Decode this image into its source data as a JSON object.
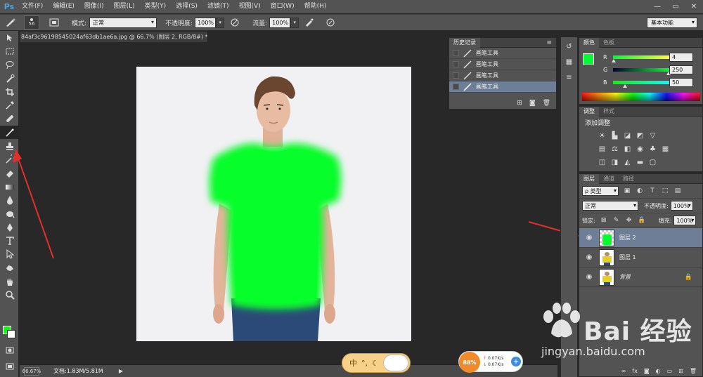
{
  "app": {
    "logo": "Ps"
  },
  "menu": [
    "文件(F)",
    "编辑(E)",
    "图像(I)",
    "图层(L)",
    "类型(Y)",
    "选择(S)",
    "滤镜(T)",
    "视图(V)",
    "窗口(W)",
    "帮助(H)"
  ],
  "window_controls": {
    "minimize": "—",
    "restore": "▭",
    "close": "✕"
  },
  "options": {
    "brush_size": "56",
    "mode_label": "模式:",
    "mode_value": "正常",
    "opacity_label": "不透明度:",
    "opacity_value": "100%",
    "flow_label": "流量:",
    "flow_value": "100%",
    "workspace": "基本功能"
  },
  "document": {
    "tab_title": "84af3c96198545024af63db1ae6a.jpg @ 66.7% (图层 2, RGB/8#) *",
    "zoom": "66.67%",
    "doc_size": "文档:1.83M/5.81M"
  },
  "history": {
    "tabs": [
      "历史记录"
    ],
    "items": [
      "画笔工具",
      "画笔工具",
      "画笔工具",
      "画笔工具"
    ],
    "selected_index": 3
  },
  "color_panel": {
    "tabs": [
      "颜色",
      "色板"
    ],
    "foreground": "#04fa32",
    "r": "4",
    "g": "250",
    "b": "50",
    "r_level": 0.016,
    "g_level": 0.98,
    "b_level": 0.196
  },
  "adjustments": {
    "tabs": [
      "调整",
      "样式"
    ],
    "title": "添加调整"
  },
  "layers": {
    "tabs": [
      "图层",
      "通道",
      "路径"
    ],
    "filter": "ρ 类型",
    "blend": "正常",
    "opacity_label": "不透明度:",
    "opacity": "100%",
    "lock_label": "锁定:",
    "fill_label": "填充:",
    "fill": "100%",
    "items": [
      {
        "name": "图层 2",
        "selected": true
      },
      {
        "name": "图层 1",
        "selected": false
      },
      {
        "name": "背景",
        "selected": false,
        "locked": true
      }
    ]
  },
  "taskbar": {
    "ime_label": "中",
    "net_percent": "88%",
    "up_speed": "0.07K/s",
    "down_speed": "0.07K/s",
    "plus": "+"
  },
  "watermark": {
    "main": "Bai 经验",
    "url": "jingyan.baidu.com"
  },
  "colors": {
    "accent_green": "#00ff00",
    "selection": "#6e7e96",
    "arrow": "#e0302a"
  }
}
